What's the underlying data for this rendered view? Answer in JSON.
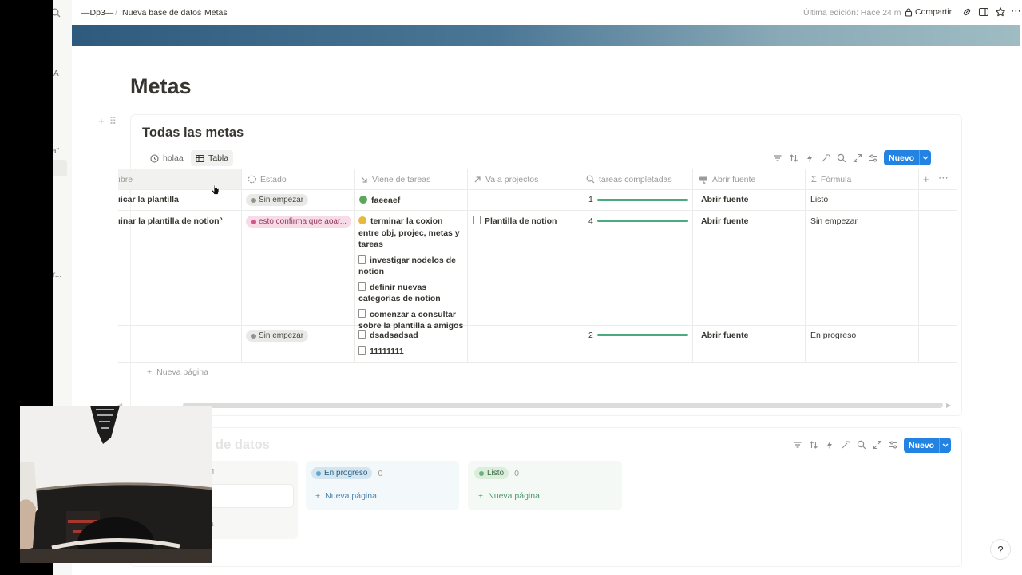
{
  "sidebar": {
    "fragments": [
      "A",
      "a\"",
      "r..."
    ]
  },
  "topbar": {
    "breadcrumbs": [
      "—Dp3—",
      "Nueva base de datos",
      "Metas"
    ],
    "separator": "/",
    "last_edited": "Última edición: Hace 24 m",
    "share_label": "Compartir"
  },
  "page": {
    "title": "Metas"
  },
  "database": {
    "title": "Todas las metas",
    "views": [
      {
        "label": "holaa",
        "icon": "clock-icon"
      },
      {
        "label": "Tabla",
        "icon": "table-icon"
      }
    ],
    "new_button": "Nuevo",
    "columns": [
      {
        "label": "ıbre",
        "icon": ""
      },
      {
        "label": "Estado",
        "icon": "status-icon"
      },
      {
        "label": "Viene de tareas",
        "icon": "arrow-down-right-icon"
      },
      {
        "label": "Va a projectos",
        "icon": "arrow-up-right-icon"
      },
      {
        "label": "tareas completadas",
        "icon": "search-icon"
      },
      {
        "label": "Abrir fuente",
        "icon": "button-icon"
      },
      {
        "label": "Fórmula",
        "icon": "sigma-icon"
      }
    ],
    "rows": [
      {
        "name": "ıicar la plantilla",
        "status": {
          "label": "Sin empezar",
          "color": "grey"
        },
        "tareas": [
          {
            "label": "faeeaef",
            "icon": "green-emoji"
          }
        ],
        "projectos": [],
        "completed": 1,
        "progress": 1.0,
        "button": "Abrir fuente",
        "formula": "Listo"
      },
      {
        "name": "ıinar la plantilla de notionº",
        "status": {
          "label": "esto confirma que aoar...",
          "color": "pink"
        },
        "tareas": [
          {
            "label": "terminar la coxion entre obj, projec, metas y tareas",
            "icon": "yellow-emoji"
          },
          {
            "label": "investigar nodelos de notion",
            "icon": "doc"
          },
          {
            "label": "definir nuevas categorias de notion",
            "icon": "doc"
          },
          {
            "label": "comenzar a consultar sobre la plantilla a amigos",
            "icon": "doc"
          }
        ],
        "projectos": [
          {
            "label": "Plantilla de notion",
            "icon": "doc"
          }
        ],
        "completed": 4,
        "progress": 1.0,
        "button": "Abrir fuente",
        "formula": "Sin empezar"
      },
      {
        "name": "",
        "status": {
          "label": "Sin empezar",
          "color": "grey"
        },
        "tareas": [
          {
            "label": "dsadsadsad",
            "icon": "doc"
          },
          {
            "label": "11111111",
            "icon": "doc"
          }
        ],
        "projectos": [],
        "completed": 2,
        "progress": 1.0,
        "button": "Abrir fuente",
        "formula": "En progreso"
      }
    ],
    "new_page": "Nueva página"
  },
  "board": {
    "title_partial": "de datos",
    "new_button": "Nuevo",
    "columns": [
      {
        "label": "En progreso",
        "count": "0",
        "color": "blue",
        "new_page": "Nueva página"
      },
      {
        "label": "Listo",
        "count": "0",
        "color": "green",
        "new_page": "Nueva página"
      }
    ],
    "partial_left": {
      "count": "1",
      "text": "a"
    }
  },
  "colors": {
    "accent": "#2383e2",
    "progress": "#4aab7e"
  }
}
